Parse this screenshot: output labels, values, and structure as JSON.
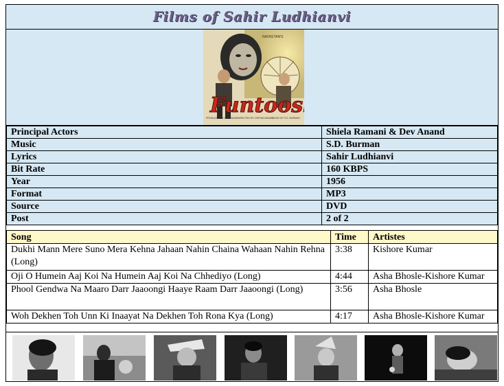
{
  "page": {
    "title": "Films of Sahir Ludhianvi"
  },
  "poster": {
    "text": "Funtoosh",
    "small_top": "NAVKETAN'S",
    "credit_1": "PRODUCED BY DEV ANAND",
    "credit_2": "DIRECTED BY CHETAN ANAND",
    "credit_3": "MUSIC BY S.D. BURMAN"
  },
  "info": [
    {
      "label": "Principal Actors",
      "value": "Shiela Ramani & Dev Anand"
    },
    {
      "label": "Music",
      "value": "S.D. Burman"
    },
    {
      "label": "Lyrics",
      "value": "Sahir Ludhianvi"
    },
    {
      "label": "Bit Rate",
      "value": "160 KBPS"
    },
    {
      "label": "Year",
      "value": "1956"
    },
    {
      "label": "Format",
      "value": "MP3"
    },
    {
      "label": "Source",
      "value": "DVD"
    },
    {
      "label": "Post",
      "value": "2 of 2"
    }
  ],
  "songs": {
    "headers": {
      "song": "Song",
      "time": "Time",
      "artistes": "Artistes"
    },
    "rows": [
      {
        "song": "Dukhi Mann Mere Suno Mera Kehna Jahaan Nahin Chaina Wahaan Nahin Rehna (Long)",
        "time": "3:38",
        "artistes": "Kishore Kumar"
      },
      {
        "song": "Oji O Humein Aaj Koi Na Humein Aaj Koi Na Chhediyo (Long)",
        "time": "4:44",
        "artistes": "Asha Bhosle-Kishore Kumar"
      },
      {
        "song": "Phool Gendwa Na Maaro Darr Jaaoongi Haaye Raam Darr Jaaoongi (Long)",
        "time": "3:56",
        "artistes": "Asha Bhosle"
      },
      {
        "song": "Woh Dekhen Toh Unn Ki Inaayat Na Dekhen Toh Rona Kya (Long)",
        "time": "4:17",
        "artistes": "Asha Bhosle-Kishore Kumar"
      }
    ]
  }
}
